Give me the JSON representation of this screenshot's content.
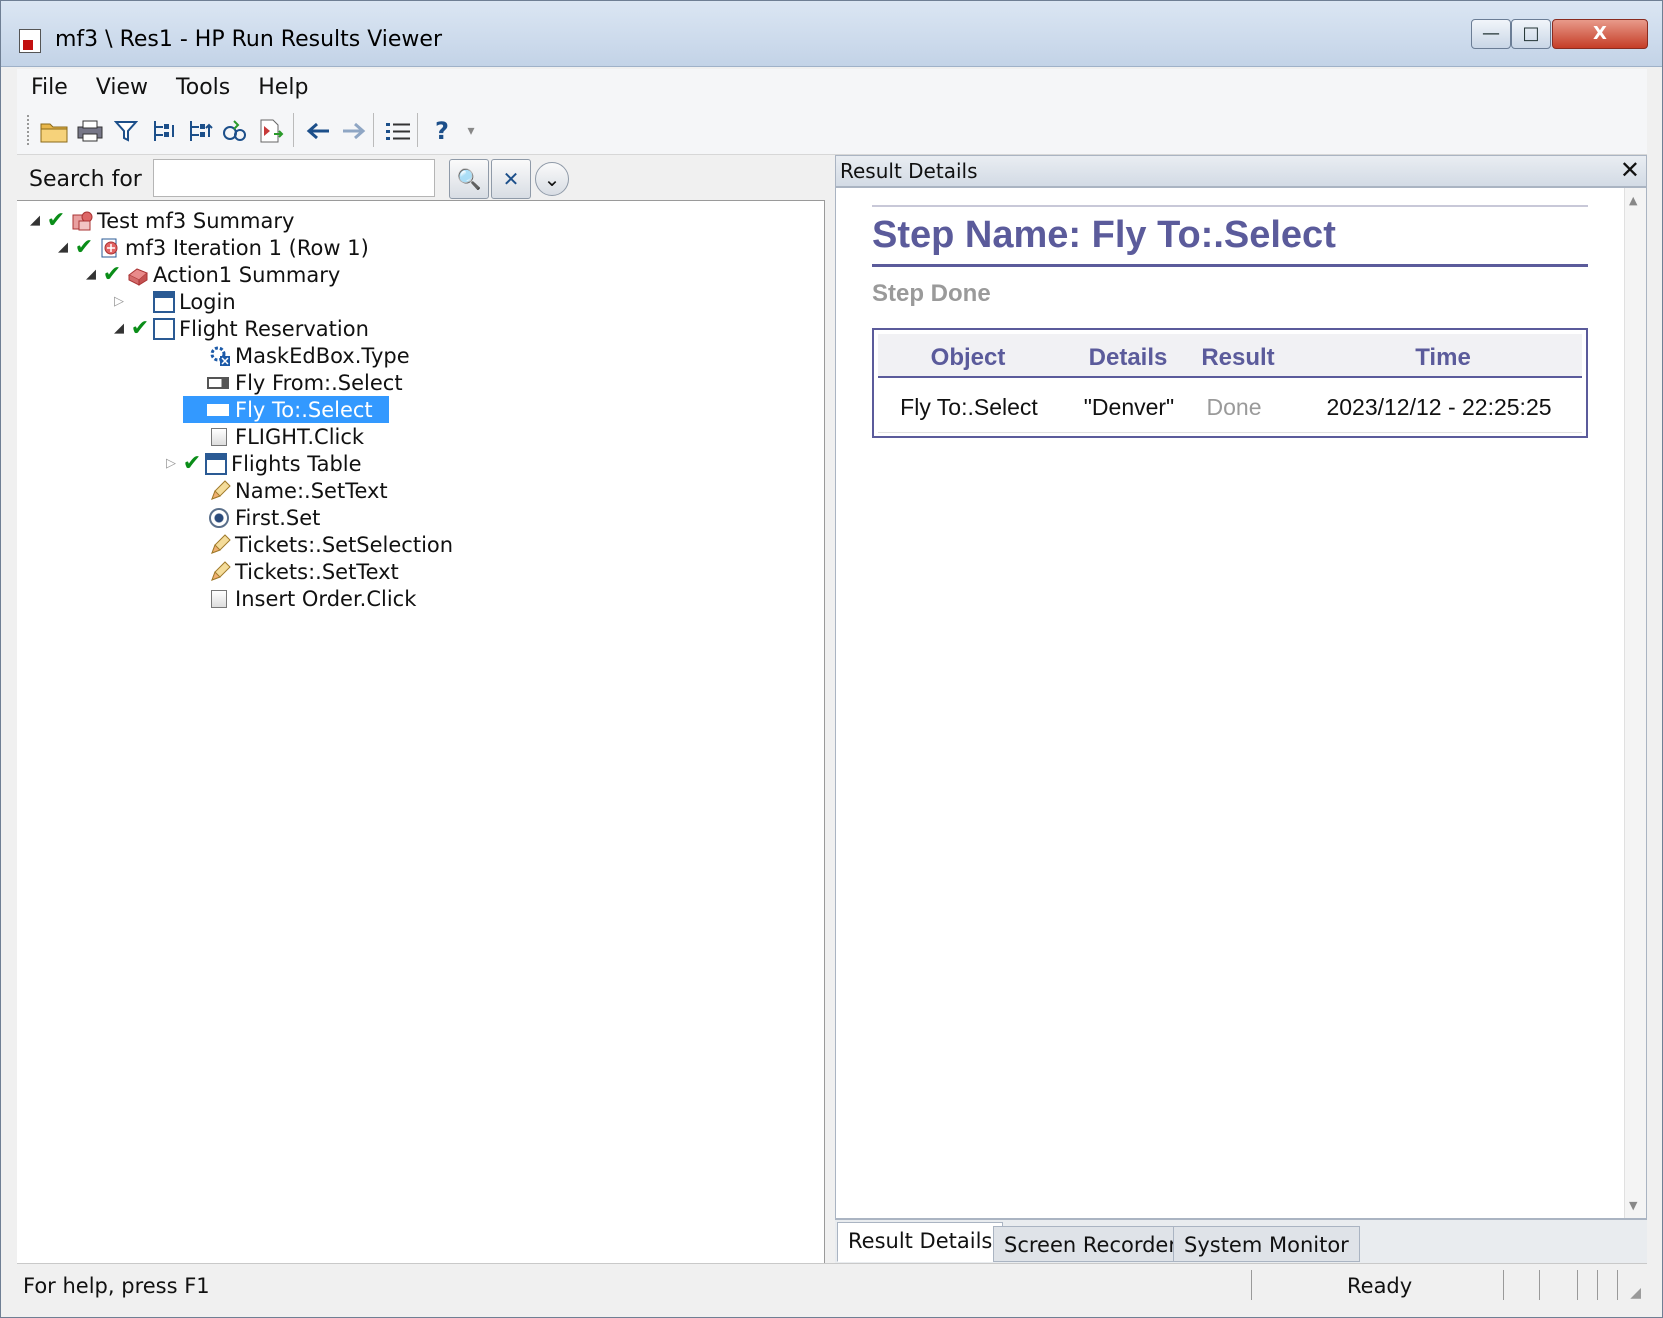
{
  "window": {
    "title": "mf3 \\ Res1 - HP Run Results Viewer",
    "controls": {
      "minimize": "—",
      "maximize": "□",
      "close": "X"
    }
  },
  "menu": [
    "File",
    "View",
    "Tools",
    "Help"
  ],
  "toolbar": {
    "buttons": [
      "open-folder-icon",
      "print-icon",
      "filter-icon",
      "expand-tree-icon",
      "collapse-tree-icon",
      "jump-to-step-icon",
      "export-icon",
      "back-arrow-icon",
      "forward-arrow-icon",
      "list-icon",
      "help-icon"
    ]
  },
  "search": {
    "label": "Search for",
    "value": "",
    "search_glyph": "🔍",
    "clear_glyph": "✕",
    "options_glyph": "⌄"
  },
  "tree": [
    {
      "label": "Test mf3 Summary",
      "arrow": "◢",
      "check": "✔",
      "icon": "summary-icon"
    },
    {
      "label": "mf3 Iteration 1 (Row 1)",
      "arrow": "◢",
      "check": "✔",
      "icon": "iteration-icon"
    },
    {
      "label": "Action1 Summary",
      "arrow": "◢",
      "check": "✔",
      "icon": "action-icon"
    },
    {
      "label": "Login",
      "arrow": "▷",
      "check": "",
      "icon": "window-icon"
    },
    {
      "label": "Flight Reservation",
      "arrow": "◢",
      "check": "✔",
      "icon": "window-icon"
    },
    {
      "label": "MaskEdBox.Type",
      "icon": "activex-icon"
    },
    {
      "label": "Fly From:.Select",
      "icon": "combobox-icon"
    },
    {
      "label": "Fly To:.Select",
      "icon": "combobox-icon",
      "selected": true
    },
    {
      "label": "FLIGHT.Click",
      "icon": "button-icon"
    },
    {
      "label": "Flights Table",
      "arrow": "▷",
      "check": "✔",
      "icon": "window-icon"
    },
    {
      "label": "Name:.SetText",
      "icon": "edit-icon"
    },
    {
      "label": "First.Set",
      "icon": "radio-icon"
    },
    {
      "label": "Tickets:.SetSelection",
      "icon": "edit-icon"
    },
    {
      "label": "Tickets:.SetText",
      "icon": "edit-icon"
    },
    {
      "label": "Insert Order.Click",
      "icon": "button-icon"
    }
  ],
  "details": {
    "pane_title": "Result Details",
    "close_glyph": "✕",
    "step_name": "Step Name: Fly To:.Select",
    "step_status": "Step Done",
    "table": {
      "headers": [
        "Object",
        "Details",
        "Result",
        "Time"
      ],
      "row": [
        "Fly To:.Select",
        "\"Denver\"",
        "Done",
        "2023/12/12 - 22:25:25"
      ]
    }
  },
  "tabs": [
    "Result Details",
    "Screen Recorder",
    "System Monitor"
  ],
  "status": {
    "help": "For help, press F1",
    "state": "Ready"
  },
  "colors": {
    "accent": "#5b5b9b",
    "selection": "#3399ff",
    "pass": "#0a8d18"
  }
}
